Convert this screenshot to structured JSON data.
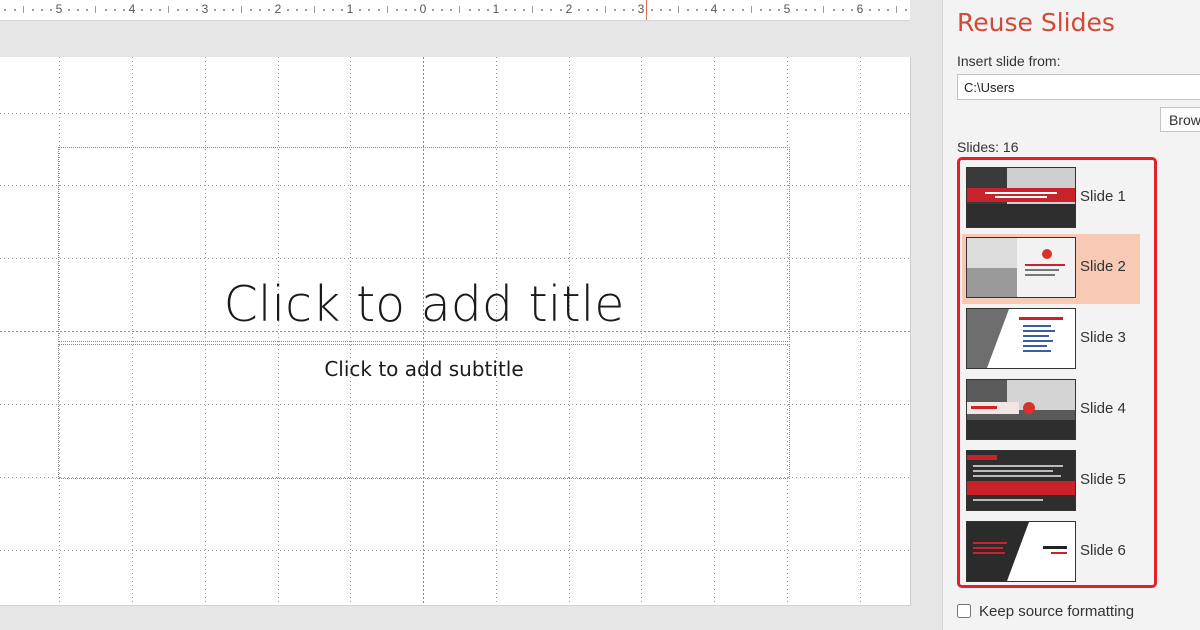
{
  "ruler": {
    "labels": [
      "5",
      "4",
      "3",
      "2",
      "1",
      "0",
      "1",
      "2",
      "3",
      "4",
      "5",
      "6"
    ]
  },
  "slide": {
    "title_placeholder": "Click to add title",
    "subtitle_placeholder": "Click to add subtitle"
  },
  "pane": {
    "title": "Reuse Slides",
    "insert_label": "Insert slide from:",
    "path_value": "C:\\Users",
    "browse_label": "Brow",
    "slides_count": "Slides: 16",
    "slides": [
      {
        "label": "Slide 1",
        "selected": false
      },
      {
        "label": "Slide 2",
        "selected": true
      },
      {
        "label": "Slide 3",
        "selected": false
      },
      {
        "label": "Slide 4",
        "selected": false
      },
      {
        "label": "Slide 5",
        "selected": false
      },
      {
        "label": "Slide 6",
        "selected": false
      }
    ],
    "keep_source_label": "Keep source formatting",
    "keep_source_checked": false
  },
  "colors": {
    "accent": "#d04a36",
    "highlight": "#f8c9b5",
    "selection_outline": "#e0202a"
  }
}
